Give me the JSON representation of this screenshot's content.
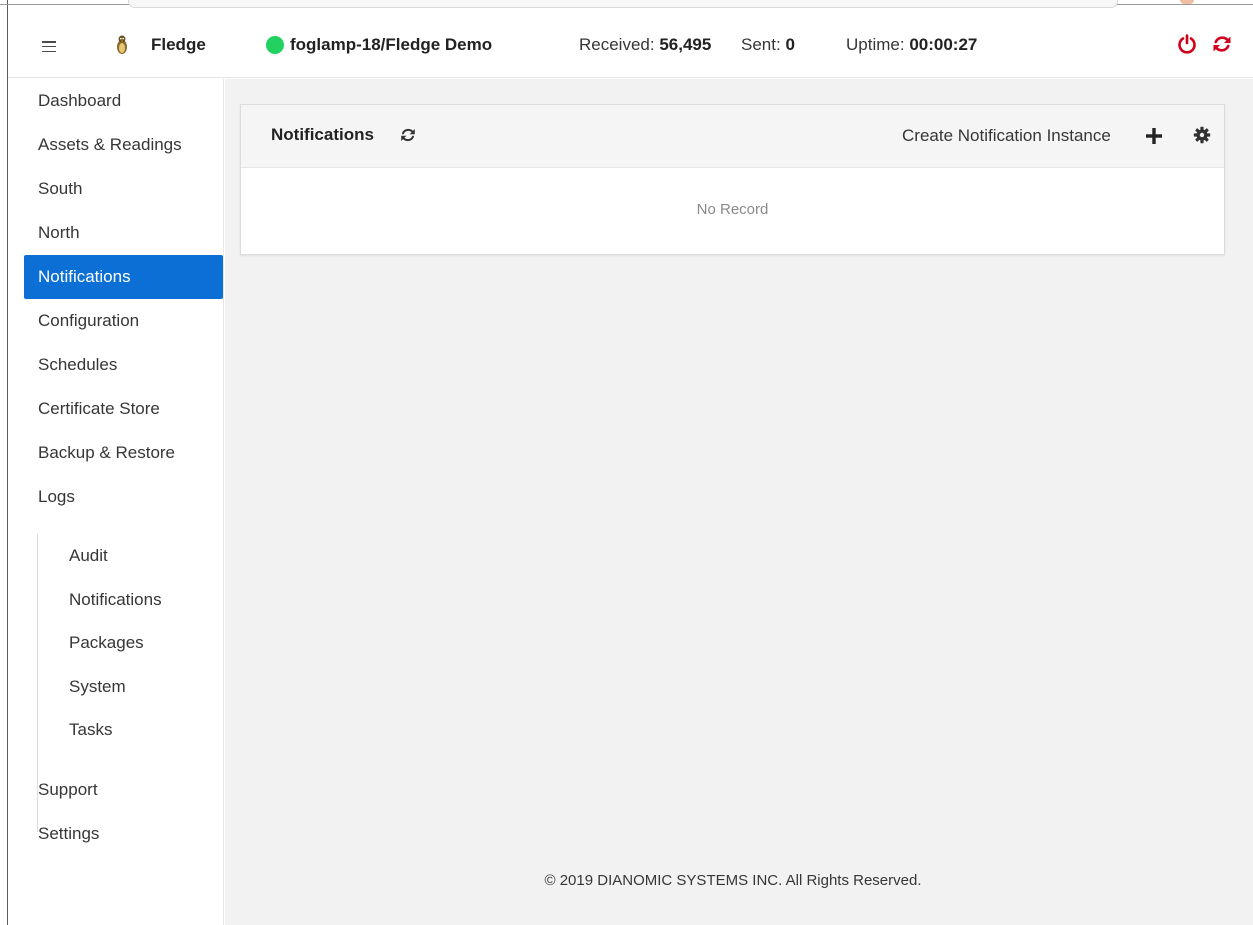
{
  "navbar": {
    "brand": "Fledge",
    "service_name": "foglamp-18/Fledge Demo",
    "status_color": "#23d160",
    "received_label": "Received:",
    "received_value": "56,495",
    "sent_label": "Sent:",
    "sent_value": "0",
    "uptime_label": "Uptime:",
    "uptime_value": "00:00:27",
    "action_color": "#d0021b"
  },
  "sidebar": {
    "active_color": "#0b6fd6",
    "items": [
      {
        "label": "Dashboard"
      },
      {
        "label": "Assets & Readings"
      },
      {
        "label": "South"
      },
      {
        "label": "North"
      },
      {
        "label": "Notifications",
        "active": true
      },
      {
        "label": "Configuration"
      },
      {
        "label": "Schedules"
      },
      {
        "label": "Certificate Store"
      },
      {
        "label": "Backup & Restore"
      },
      {
        "label": "Logs"
      }
    ],
    "log_items": [
      {
        "label": "Audit"
      },
      {
        "label": "Notifications"
      },
      {
        "label": "Packages"
      },
      {
        "label": "System"
      },
      {
        "label": "Tasks"
      }
    ],
    "bottom_items": [
      {
        "label": "Support"
      },
      {
        "label": "Settings"
      }
    ]
  },
  "main": {
    "card_title": "Notifications",
    "create_label": "Create Notification Instance",
    "empty_text": "No Record",
    "footer": "© 2019 DIANOMIC SYSTEMS INC. All Rights Reserved."
  }
}
